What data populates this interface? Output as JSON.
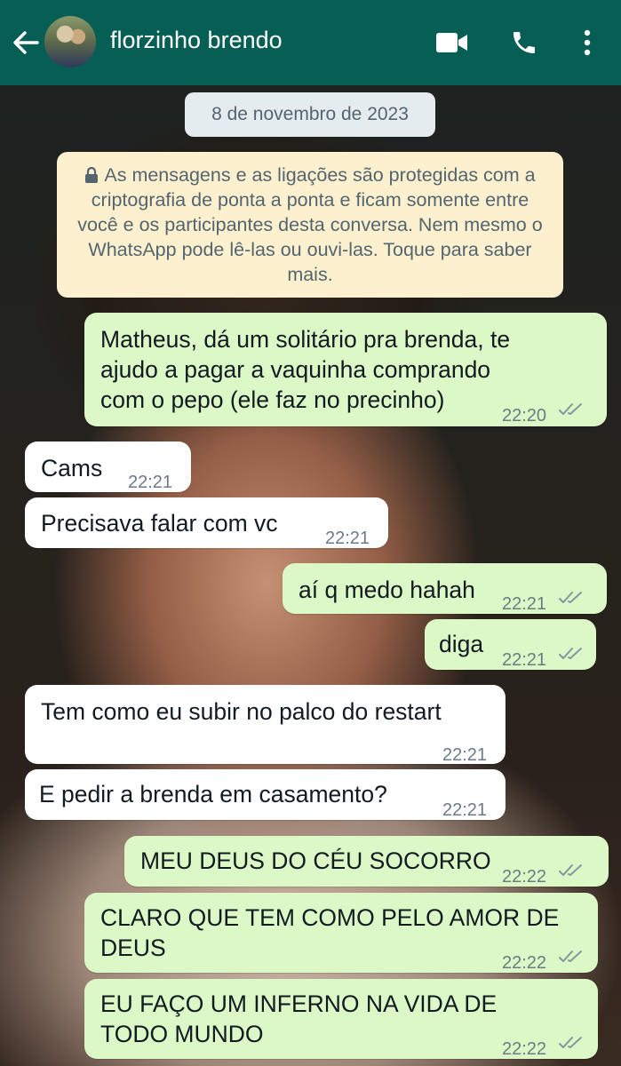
{
  "header": {
    "contact_name": "florzinho brendo",
    "icons": [
      "back-arrow-icon",
      "video-call-icon",
      "phone-icon",
      "more-vert-icon"
    ]
  },
  "chat": {
    "date": "8 de novembro de 2023",
    "encryption_notice": "As mensagens e as ligações são protegidas com a criptografia de ponta a ponta e ficam somente entre você e os participantes desta conversa. Nem mesmo o WhatsApp pode lê-las ou ouvi-las. Toque para saber mais.",
    "messages": [
      {
        "dir": "out",
        "lines": [
          "Matheus, dá um solitário pra brenda, te",
          "ajudo a pagar a vaquinha comprando",
          "com o pepo (ele faz no precinho)"
        ],
        "time": "22:20",
        "status": "read"
      },
      {
        "dir": "in",
        "lines": [
          "Cams"
        ],
        "time": "22:21"
      },
      {
        "dir": "in",
        "lines": [
          "Precisava falar com vc"
        ],
        "time": "22:21"
      },
      {
        "dir": "out",
        "lines": [
          "aí q medo hahah"
        ],
        "time": "22:21",
        "status": "read"
      },
      {
        "dir": "out",
        "lines": [
          "diga"
        ],
        "time": "22:21",
        "status": "read"
      },
      {
        "dir": "in",
        "lines": [
          "Tem como eu subir no palco do restart"
        ],
        "time": "22:21"
      },
      {
        "dir": "in",
        "lines": [
          "E pedir a brenda em casamento?"
        ],
        "time": "22:21"
      },
      {
        "dir": "out",
        "lines": [
          "MEU DEUS DO CÉU SOCORRO"
        ],
        "time": "22:22",
        "status": "read"
      },
      {
        "dir": "out",
        "lines": [
          "CLARO QUE TEM COMO PELO AMOR DE",
          "DEUS"
        ],
        "time": "22:22",
        "status": "read"
      },
      {
        "dir": "out",
        "lines": [
          "EU FAÇO UM INFERNO NA VIDA DE",
          "TODO MUNDO"
        ],
        "time": "22:22",
        "status": "read"
      }
    ]
  },
  "colors": {
    "header": "#075e54",
    "outgoing_bubble": "#dcf8c6",
    "incoming_bubble": "#ffffff",
    "system_notice": "#fcf0cf",
    "date_pill": "#e4ecef"
  }
}
